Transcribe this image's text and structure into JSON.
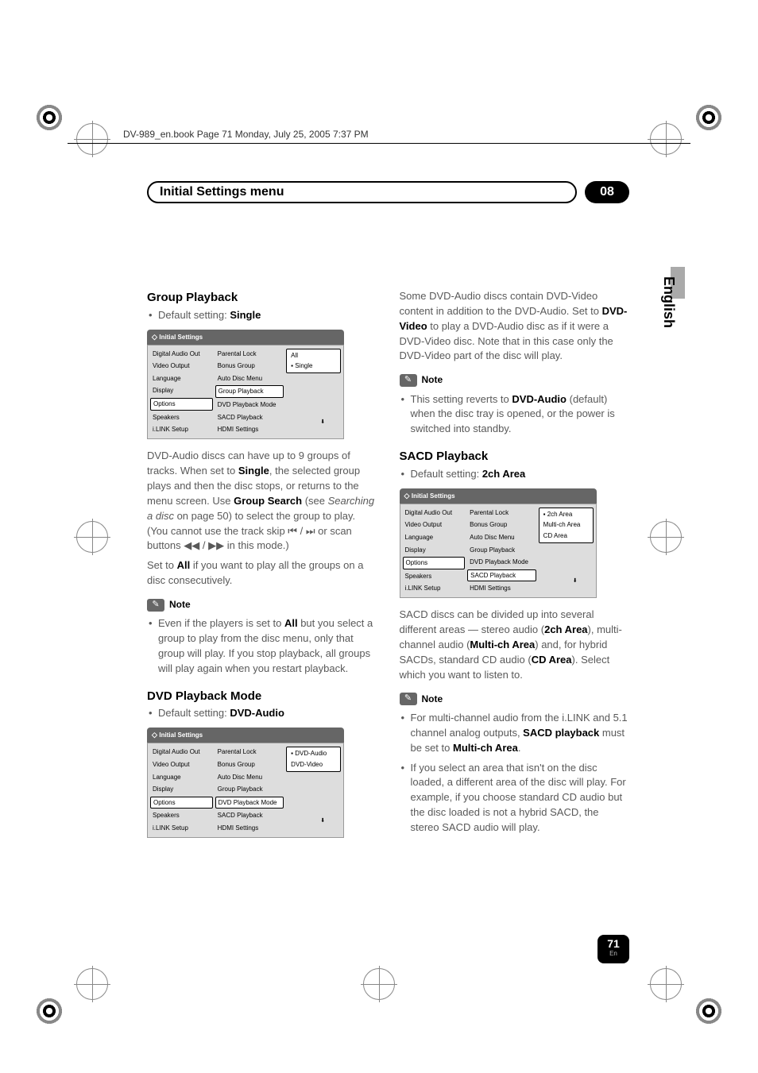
{
  "header_file": "DV-989_en.book  Page 71  Monday, July 25, 2005  7:37 PM",
  "title": "Initial Settings menu",
  "chapter": "08",
  "side_lang": "English",
  "page_number": "71",
  "page_lang": "En",
  "note_label": "Note",
  "menu_title": "Initial Settings",
  "menu_col1": [
    "Digital Audio Out",
    "Video Output",
    "Language",
    "Display",
    "Options",
    "Speakers",
    "i.LINK Setup"
  ],
  "menu_col2": [
    "Parental  Lock",
    "Bonus Group",
    "Auto Disc Menu",
    "Group Playback",
    "DVD Playback Mode",
    "SACD Playback",
    "HDMI Settings"
  ],
  "left": {
    "group_playback": {
      "heading": "Group Playback",
      "default": "Default setting: ",
      "default_val": "Single",
      "menu_c1_boxed": "Options",
      "menu_c2_boxed": "Group Playback",
      "menu_c3": [
        "All",
        "Single"
      ],
      "menu_c3_dot_idx": 1,
      "p1a": "DVD-Audio discs can have up to 9 groups of tracks. When set to ",
      "p1b": "Single",
      "p1c": ", the selected group plays and then the disc stops, or returns to the menu screen. Use ",
      "p1d": "Group Search",
      "p1e": " (see ",
      "p1f": "Searching a disc",
      "p1g": " on page 50) to select the group to play. (You cannot use the track skip ",
      "p1h": " / ",
      "p1i": " or scan buttons ",
      "p1j": " / ",
      "p1k": " in this mode.)",
      "p2a": "Set to ",
      "p2b": "All",
      "p2c": " if you want to play all the groups on a disc consecutively.",
      "note_a": "Even if the players is set to ",
      "note_b": "All",
      "note_c": " but you select a group to play from the disc menu, only that group will play. If you stop playback, all groups will play again when you restart playback."
    },
    "dvd_mode": {
      "heading": "DVD Playback Mode",
      "default": "Default setting: ",
      "default_val": "DVD-Audio",
      "menu_c1_boxed": "Options",
      "menu_c2_boxed": "DVD Playback Mode",
      "menu_c3": [
        "DVD-Audio",
        "DVD-Video"
      ],
      "menu_c3_dot_idx": 0
    }
  },
  "right": {
    "intro_a": "Some DVD-Audio discs contain DVD-Video content in addition to the DVD-Audio. Set to ",
    "intro_b": "DVD-Video",
    "intro_c": " to play a DVD-Audio disc as if it were a DVD-Video disc. Note that in this case only the DVD-Video part of the disc will play.",
    "note1_a": "This setting reverts to ",
    "note1_b": "DVD-Audio",
    "note1_c": " (default) when the disc tray is opened, or the power is switched into standby.",
    "sacd": {
      "heading": "SACD Playback",
      "default": "Default setting: ",
      "default_val": "2ch Area",
      "menu_c1_boxed": "Options",
      "menu_c2_boxed": "SACD Playback",
      "menu_c3": [
        "2ch Area",
        "Multi-ch Area",
        "CD Area"
      ],
      "menu_c3_dot_idx": 0,
      "p_a": "SACD discs can be divided up into several different areas — stereo audio (",
      "p_b": "2ch Area",
      "p_c": "), multi-channel audio (",
      "p_d": "Multi-ch Area",
      "p_e": ") and, for hybrid SACDs, standard CD audio (",
      "p_f": "CD Area",
      "p_g": "). Select which you want to listen to.",
      "note2_a": "For multi-channel audio from the i.LINK and 5.1 channel analog outputs, ",
      "note2_b": "SACD playback",
      "note2_c": " must be set to ",
      "note2_d": "Multi-ch Area",
      "note2_e": ".",
      "note3": "If you select an area that isn't on the disc loaded, a different area of the disc will play. For example, if you choose standard CD audio but the disc loaded is not a hybrid SACD, the stereo SACD audio will play."
    }
  },
  "sym": {
    "prev": "⏮",
    "next": "⏭",
    "rw": "◀◀",
    "ff": "▶▶"
  }
}
